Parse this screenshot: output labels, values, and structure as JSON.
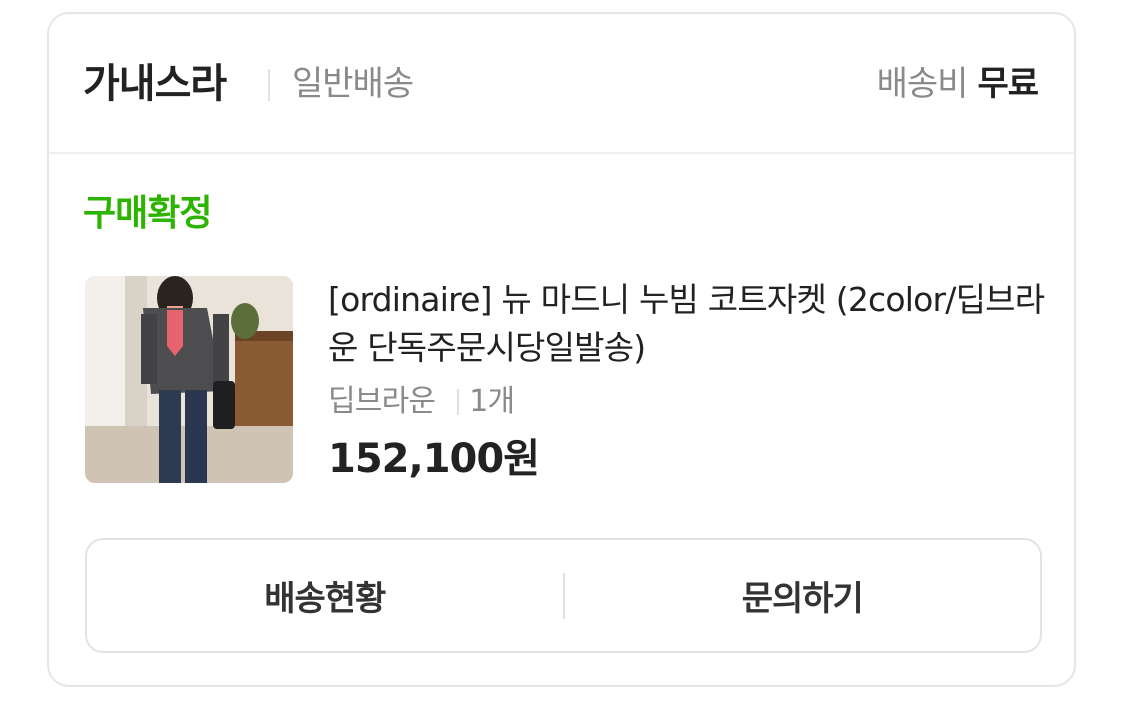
{
  "header": {
    "seller_name": "가내스라",
    "shipping_type": "일반배송",
    "shipping_fee_label": "배송비",
    "shipping_fee_value": "무료"
  },
  "order": {
    "status": "구매확정",
    "status_color": "#2db400",
    "product_name": "[ordinaire] 뉴 마드니 누빔 코트자켓 (2color/딥브라운 단독주문시당일발송)",
    "option": "딥브라운",
    "quantity": "1개",
    "price": "152,100원"
  },
  "actions": {
    "tracking_label": "배송현황",
    "inquiry_label": "문의하기"
  }
}
